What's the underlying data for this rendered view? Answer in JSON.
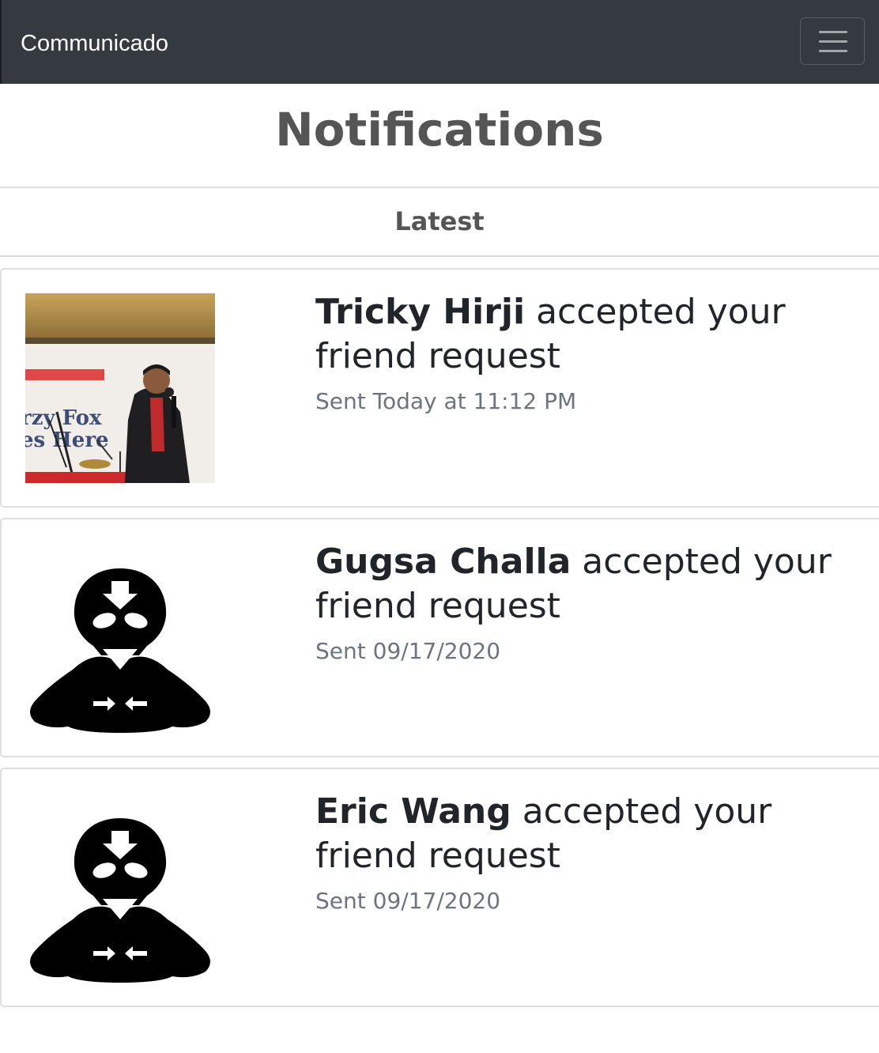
{
  "navbar": {
    "brand": "Communicado",
    "toggle_icon": "hamburger-menu-icon"
  },
  "page": {
    "title": "Notifications",
    "section_header": "Latest"
  },
  "notifications": [
    {
      "name": "Tricky Hirji",
      "action": " accepted your friend request",
      "sent": "Sent Today at 11:12 PM",
      "avatar": "user-photo",
      "photo_banner_text": [
        "rzy Fox",
        "es Here"
      ]
    },
    {
      "name": "Gugsa Challa",
      "action": " accepted your friend request",
      "sent": "Sent 09/17/2020",
      "avatar": "default-avatar-icon"
    },
    {
      "name": "Eric Wang",
      "action": " accepted your friend request",
      "sent": "Sent 09/17/2020",
      "avatar": "default-avatar-icon"
    }
  ],
  "colors": {
    "navbar_bg": "#343a40",
    "title_gray": "#555555",
    "muted": "#6c757d",
    "text": "#212529"
  }
}
